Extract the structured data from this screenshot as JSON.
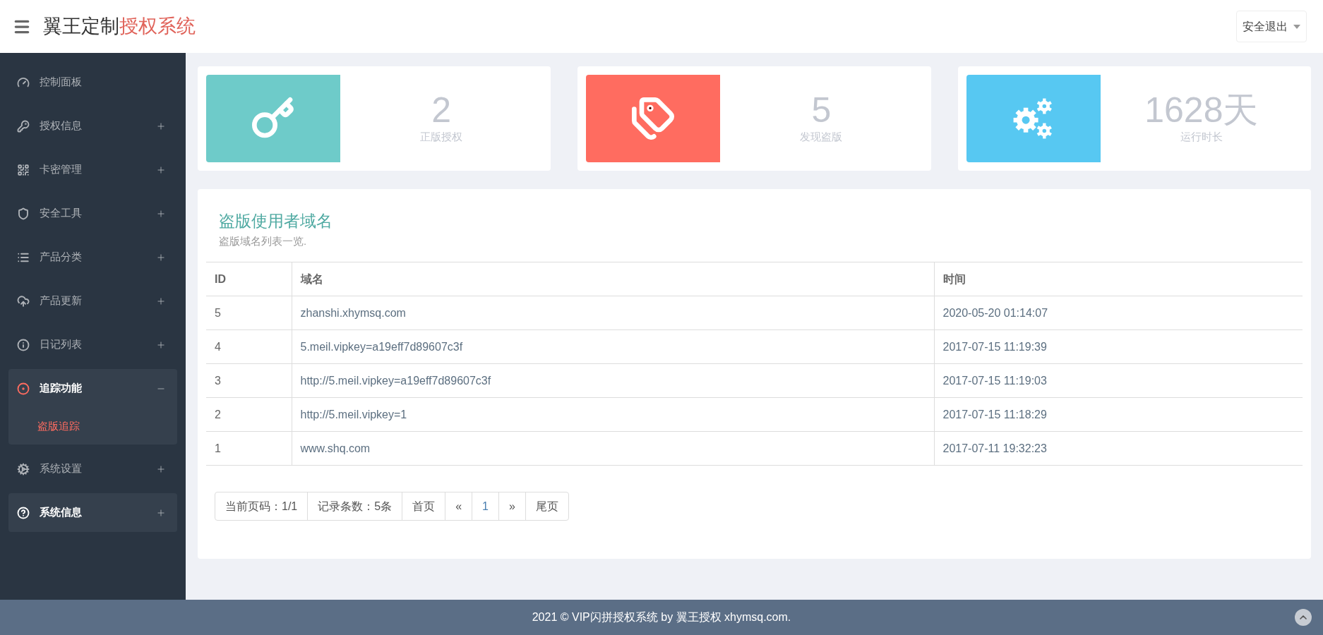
{
  "header": {
    "title": "翼王定制",
    "title_accent": "授权系统",
    "logout": "安全退出"
  },
  "sidebar": {
    "items": [
      {
        "label": "控制面板",
        "kind": "link",
        "active": false
      },
      {
        "label": "授权信息",
        "kind": "group",
        "expanded": false,
        "active": false
      },
      {
        "label": "卡密管理",
        "kind": "group",
        "expanded": false,
        "active": false
      },
      {
        "label": "安全工具",
        "kind": "group",
        "expanded": false,
        "active": false
      },
      {
        "label": "产品分类",
        "kind": "group",
        "expanded": false,
        "active": false
      },
      {
        "label": "产品更新",
        "kind": "group",
        "expanded": false,
        "active": false
      },
      {
        "label": "日记列表",
        "kind": "group",
        "expanded": false,
        "active": false
      },
      {
        "label": "追踪功能",
        "kind": "group",
        "expanded": true,
        "active": true,
        "children": [
          {
            "label": "盗版追踪",
            "selected": true
          }
        ]
      },
      {
        "label": "系统设置",
        "kind": "group",
        "expanded": false,
        "active": false
      },
      {
        "label": "系统信息",
        "kind": "group",
        "expanded": false,
        "active": true
      }
    ]
  },
  "stats": [
    {
      "value": "2",
      "label": "正版授权",
      "color": "#6ecbc9"
    },
    {
      "value": "5",
      "label": "发现盗版",
      "color": "#ff6c60"
    },
    {
      "value": "1628天",
      "label": "运行时长",
      "color": "#57c8f2"
    }
  ],
  "panel": {
    "title": "盗版使用者域名",
    "subtitle": "盗版域名列表一览.",
    "table": {
      "columns": [
        "ID",
        "域名",
        "时间"
      ],
      "rows": [
        [
          "5",
          "zhanshi.xhymsq.com",
          "2020-05-20 01:14:07"
        ],
        [
          "4",
          "5.meil.vipkey=a19eff7d89607c3f",
          "2017-07-15 11:19:39"
        ],
        [
          "3",
          "http://5.meil.vipkey=a19eff7d89607c3f",
          "2017-07-15 11:19:03"
        ],
        [
          "2",
          "http://5.meil.vipkey=1",
          "2017-07-15 11:18:29"
        ],
        [
          "1",
          "www.shq.com",
          "2017-07-11 19:32:23"
        ]
      ]
    },
    "pagination": [
      {
        "label": "当前页码：1/1",
        "selected": false
      },
      {
        "label": "记录条数：5条",
        "selected": false
      },
      {
        "label": "首页",
        "selected": false
      },
      {
        "label": "«",
        "selected": false
      },
      {
        "label": "1",
        "selected": true
      },
      {
        "label": "»",
        "selected": false
      },
      {
        "label": "尾页",
        "selected": false
      }
    ]
  },
  "footer": {
    "text": "2021 © VIP闪拼授权系统 by 翼王授权 xhymsq.com."
  }
}
